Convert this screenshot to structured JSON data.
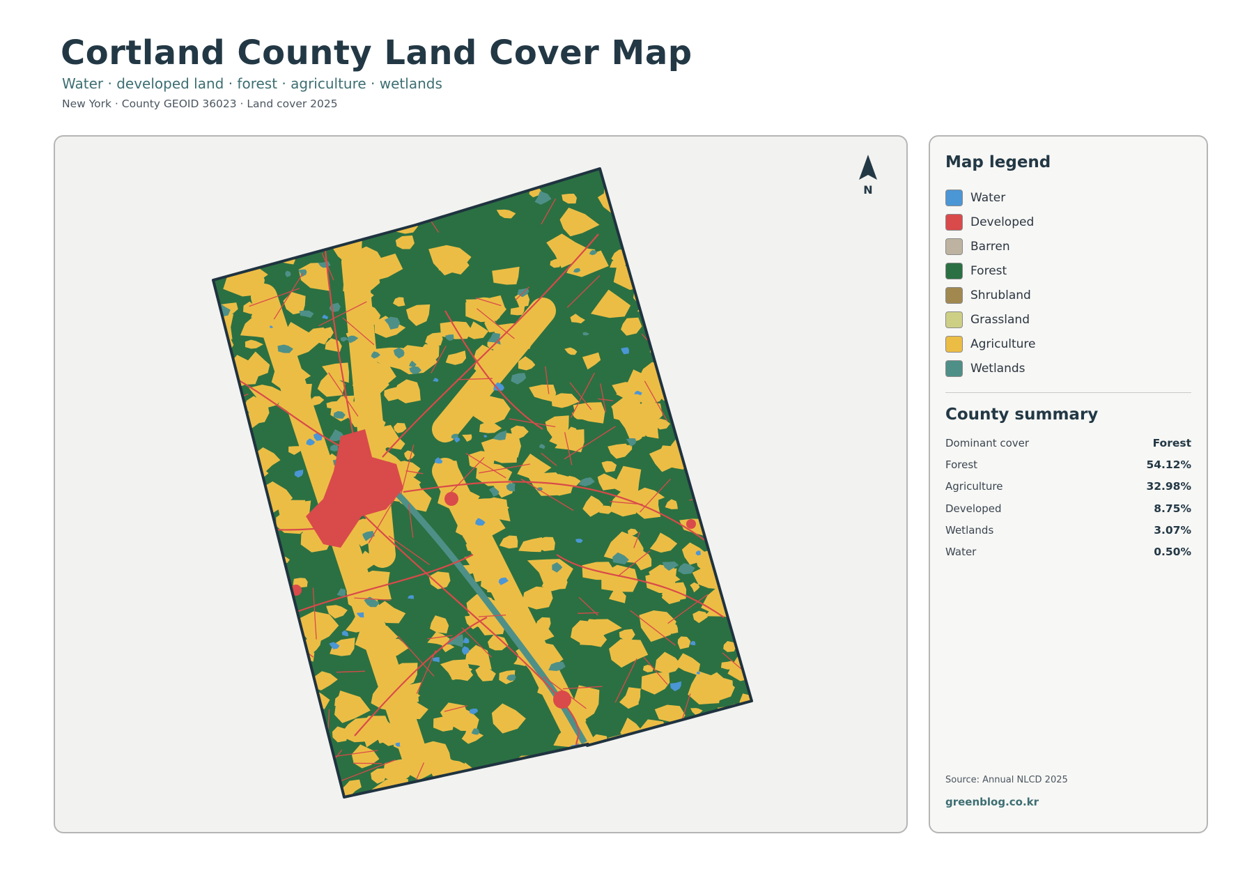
{
  "header": {
    "title": "Cortland County Land Cover Map",
    "subtitle": "Water · developed land · forest · agriculture · wetlands",
    "meta": "New York · County GEOID 36023 · Land cover 2025"
  },
  "map": {
    "north_label": "N",
    "colors": {
      "background": "#f2f2f0",
      "outline": "#1f3340",
      "water": "#4b96d5",
      "developed": "#d94a4a",
      "forest": "#2b7042",
      "agriculture": "#ecbd45",
      "wetlands": "#4e9088",
      "barren": "#bdb3a0"
    }
  },
  "legend": {
    "title": "Map legend",
    "items": [
      {
        "label": "Water",
        "color": "#4b96d5"
      },
      {
        "label": "Developed",
        "color": "#d94a4a"
      },
      {
        "label": "Barren",
        "color": "#bdb3a0"
      },
      {
        "label": "Forest",
        "color": "#2b7042"
      },
      {
        "label": "Shrubland",
        "color": "#a0884f"
      },
      {
        "label": "Grassland",
        "color": "#cdcf85"
      },
      {
        "label": "Agriculture",
        "color": "#ecbd45"
      },
      {
        "label": "Wetlands",
        "color": "#4e9088"
      }
    ]
  },
  "summary": {
    "title": "County summary",
    "rows": [
      {
        "label": "Dominant cover",
        "value": "Forest"
      },
      {
        "label": "Forest",
        "value": "54.12%"
      },
      {
        "label": "Agriculture",
        "value": "32.98%"
      },
      {
        "label": "Developed",
        "value": "8.75%"
      },
      {
        "label": "Wetlands",
        "value": "3.07%"
      },
      {
        "label": "Water",
        "value": "0.50%"
      }
    ]
  },
  "footer": {
    "source": "Source: Annual NLCD 2025",
    "credit": "greenblog.co.kr"
  }
}
